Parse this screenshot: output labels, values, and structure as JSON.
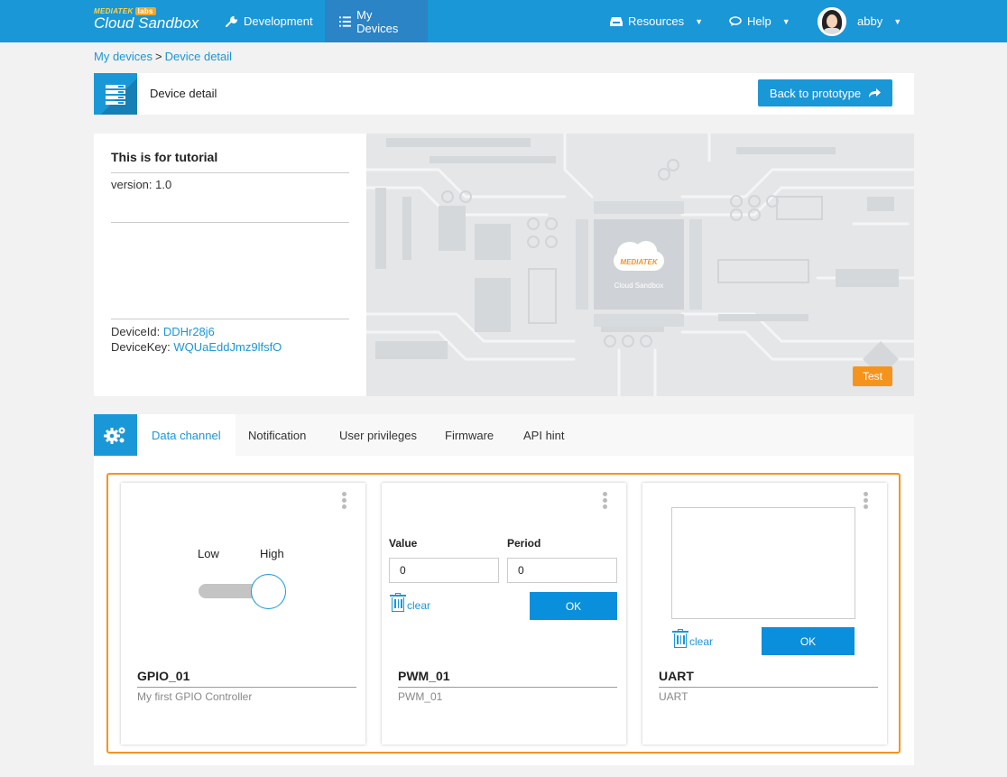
{
  "nav": {
    "logo_top": "MEDIATEK",
    "logo_labs": "labs",
    "logo_main": "Cloud Sandbox",
    "development": "Development",
    "my_devices": "My Devices",
    "resources": "Resources",
    "help": "Help",
    "user": "abby"
  },
  "breadcrumb": {
    "parent": "My devices",
    "separator": ">",
    "current": "Device detail"
  },
  "header": {
    "title": "Device detail",
    "back_button": "Back to prototype"
  },
  "device": {
    "name": "This is for tutorial",
    "version": "version: 1.0",
    "device_id_label": "DeviceId:",
    "device_id": "DDHr28j6",
    "device_key_label": "DeviceKey:",
    "device_key": "WQUaEddJmz9lfsfO",
    "badge": "Test",
    "hero_chip_brand": "MEDIATEK",
    "hero_chip_product": "Cloud Sandbox"
  },
  "tabs": [
    {
      "label": "Data channel"
    },
    {
      "label": "Notification"
    },
    {
      "label": "User privileges"
    },
    {
      "label": "Firmware"
    },
    {
      "label": "API hint"
    }
  ],
  "channels": {
    "gpio": {
      "low": "Low",
      "high": "High",
      "name": "GPIO_01",
      "description": "My first GPIO Controller"
    },
    "pwm": {
      "value_label": "Value",
      "period_label": "Period",
      "value": "0",
      "period": "0",
      "clear": "clear",
      "ok": "OK",
      "name": "PWM_01",
      "description": "PWM_01"
    },
    "uart": {
      "clear": "clear",
      "ok": "OK",
      "name": "UART",
      "description": "UART"
    }
  },
  "colors": {
    "brand_blue": "#1a97d6",
    "accent_orange": "#f5941d"
  }
}
